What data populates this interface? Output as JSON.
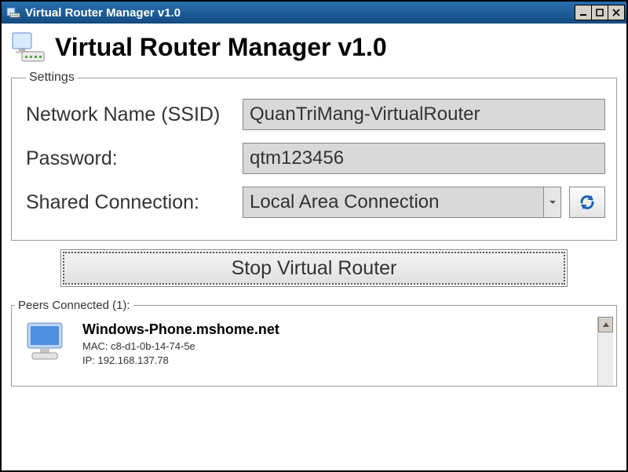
{
  "window": {
    "title": "Virtual Router Manager v1.0"
  },
  "header": {
    "app_title": "Virtual Router Manager v1.0"
  },
  "settings": {
    "legend": "Settings",
    "ssid_label": "Network Name (SSID)",
    "ssid_value": "QuanTriMang-VirtualRouter",
    "password_label": "Password:",
    "password_value": "qtm123456",
    "shared_label": "Shared Connection:",
    "shared_selected": "Local Area Connection"
  },
  "actions": {
    "stop_label": "Stop Virtual Router"
  },
  "peers": {
    "legend": "Peers Connected (1):",
    "items": [
      {
        "name": "Windows-Phone.mshome.net",
        "mac_line": "MAC: c8-d1-0b-14-74-5e",
        "ip_line": "IP: 192.168.137.78"
      }
    ]
  }
}
